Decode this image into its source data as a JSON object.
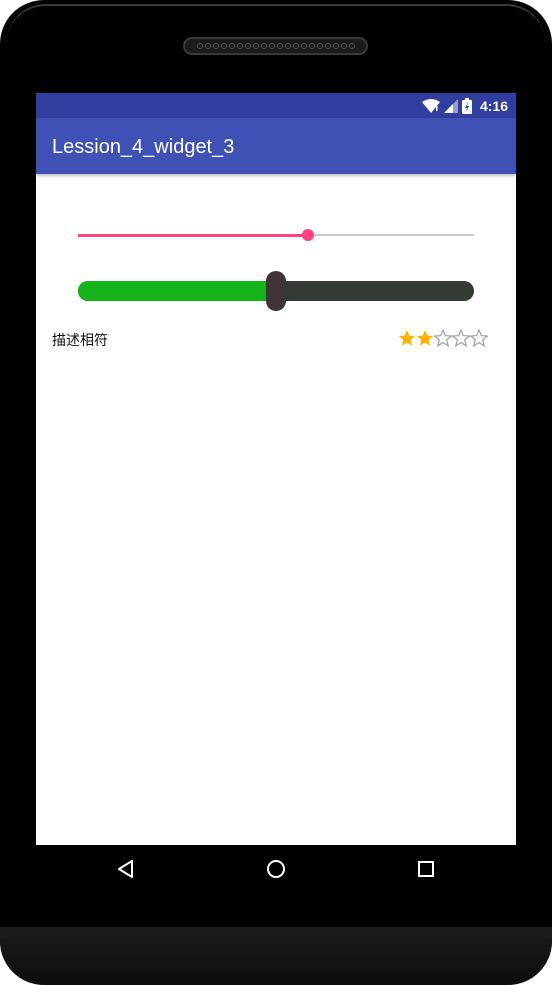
{
  "status_bar": {
    "time": "4:16",
    "icons": [
      "wifi-icon",
      "signal-icon",
      "battery-icon"
    ],
    "color": "#303f9f"
  },
  "app_bar": {
    "title": "Lession_4_widget_3",
    "color": "#3f51b5"
  },
  "seekbar_default": {
    "progress_fraction": 0.58,
    "accent_color": "#ff4081",
    "track_color": "#c8c8c8"
  },
  "seekbar_custom": {
    "progress_fraction": 0.5,
    "fill_color": "#16b21a",
    "track_color": "#363a35",
    "thumb_color": "#3f3538"
  },
  "rating": {
    "label": "描述相符",
    "value": 2,
    "max": 5,
    "filled_color": "#ffb300",
    "empty_color": "#9e9e9e"
  },
  "nav_bar": {
    "buttons": [
      "back-icon",
      "home-icon",
      "recents-icon"
    ]
  }
}
